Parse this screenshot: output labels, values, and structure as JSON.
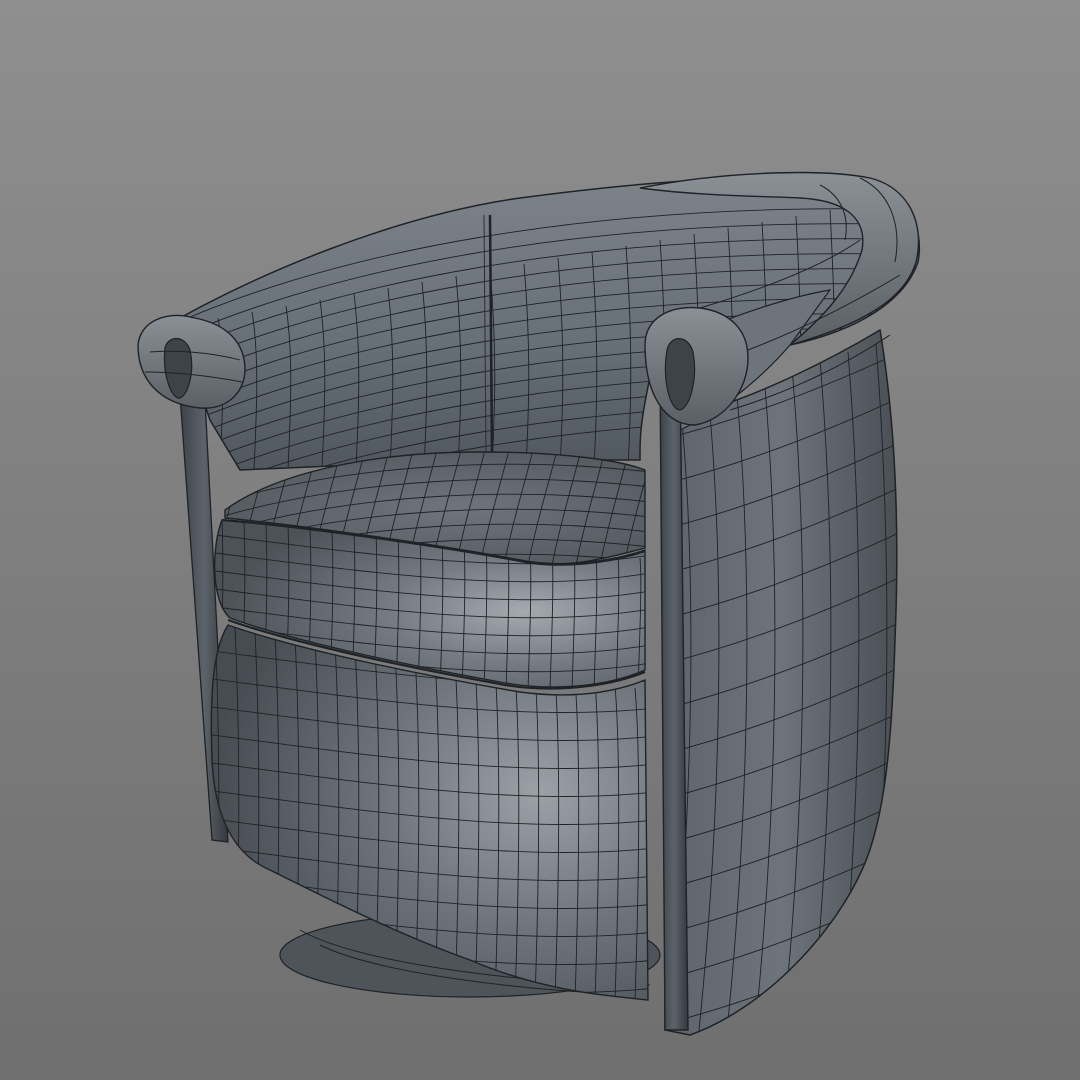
{
  "viewport": {
    "background_top": "#8f8f8f",
    "background_bottom": "#6f6f6f"
  },
  "model": {
    "subject": "tub-armchair-wireframe",
    "surface_color": "#6b7178",
    "surface_highlight": "#9aa0a6",
    "surface_shadow": "#3f454b",
    "wire_color": "#1f2226"
  }
}
